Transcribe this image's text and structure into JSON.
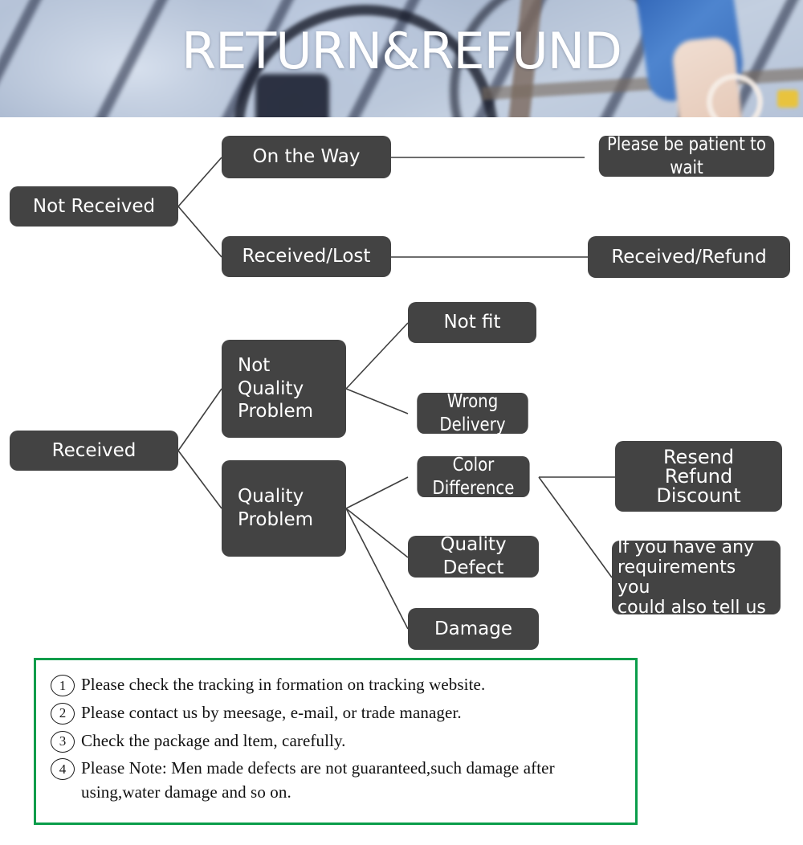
{
  "banner": {
    "title": "RETURN&REFUND",
    "title_color": "#ffffff"
  },
  "theme": {
    "node_fill": "#434343",
    "node_text": "#ffffff",
    "connector": "#3f3f3f",
    "notes_border": "#0a9d4a",
    "page_background": "#ffffff"
  },
  "flowchart": {
    "nodes": {
      "not_received": "Not Received",
      "on_the_way": "On the Way",
      "received_lost": "Received/Lost",
      "please_be_patient": "Please be patient to wait",
      "received_refund": "Received/Refund",
      "received": "Received",
      "not_quality_problem": "Not\nQuality\nProblem",
      "quality_problem": "Quality\nProblem",
      "not_fit": "Not fit",
      "wrong_delivery": "Wrong Delivery",
      "color_difference": "Color Difference",
      "quality_defect": "Quality Defect",
      "damage": "Damage",
      "resend_refund_discount": "Resend\nRefund\nDiscount",
      "if_you_have_any": "If you have any\nrequirements you\ncould also tell us"
    }
  },
  "notes": {
    "items": [
      {
        "number": "1",
        "text": "Please check the tracking in formation on tracking website."
      },
      {
        "number": "2",
        "text": "Please contact us by meesage, e-mail, or trade manager."
      },
      {
        "number": "3",
        "text": "Check the package and ltem, carefully."
      },
      {
        "number": "4",
        "text": "Please Note: Men made defects  are not guaranteed,such damage after using,water damage and so on."
      }
    ]
  }
}
